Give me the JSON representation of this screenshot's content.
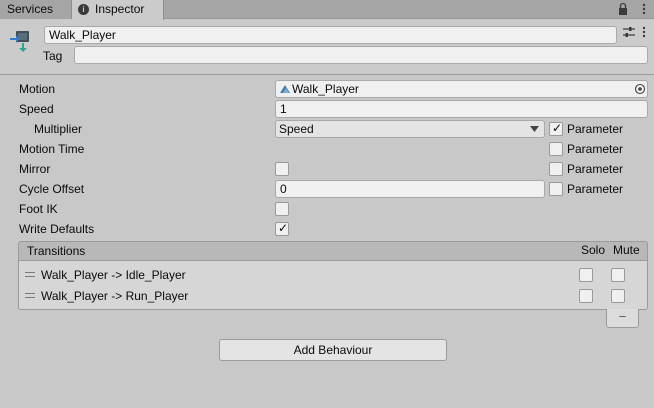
{
  "tabs": {
    "services": "Services",
    "inspector": "Inspector"
  },
  "header": {
    "name": "Walk_Player",
    "tag_label": "Tag",
    "tag_value": ""
  },
  "properties": {
    "motion": {
      "label": "Motion",
      "value": "Walk_Player"
    },
    "speed": {
      "label": "Speed",
      "value": "1"
    },
    "multiplier": {
      "label": "Multiplier",
      "value": "Speed",
      "parameter_checked": true
    },
    "motion_time": {
      "label": "Motion Time",
      "parameter_checked": false
    },
    "mirror": {
      "label": "Mirror",
      "checked": false,
      "parameter_checked": false
    },
    "cycle_offset": {
      "label": "Cycle Offset",
      "value": "0",
      "parameter_checked": false
    },
    "foot_ik": {
      "label": "Foot IK",
      "checked": false
    },
    "write_defaults": {
      "label": "Write Defaults",
      "checked": true
    },
    "parameter_label": "Parameter"
  },
  "transitions": {
    "header": "Transitions",
    "solo_label": "Solo",
    "mute_label": "Mute",
    "items": [
      {
        "label": "Walk_Player -> Idle_Player",
        "solo": false,
        "mute": false
      },
      {
        "label": "Walk_Player -> Run_Player",
        "solo": false,
        "mute": false
      }
    ],
    "remove_label": "−"
  },
  "add_behaviour_label": "Add Behaviour"
}
